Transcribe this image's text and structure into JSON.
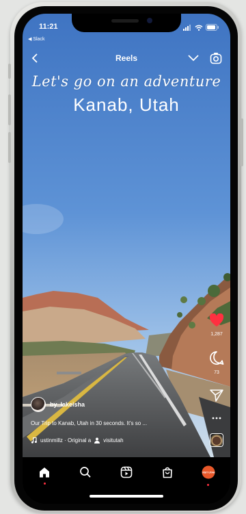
{
  "status_bar": {
    "time": "11:21",
    "back_app": "◀ Slack"
  },
  "header": {
    "title": "Reels"
  },
  "overlay": {
    "script_text": "Let's go on an adventure",
    "location_text": "Kanab, Utah"
  },
  "actions": {
    "likes": "1,287",
    "comments": "73"
  },
  "post": {
    "username": "by_lakeisha",
    "caption": "Our Trip to Kanab, Utah in 30 seconds. It's so ...",
    "audio": "ustinmillz · Original a",
    "tagged_user": "visitutah"
  },
  "tabbar": {
    "profile_label": "VISIT UTAH"
  },
  "colors": {
    "like": "#ff3040",
    "sky_top": "#3e74c4",
    "sky_bottom": "#a9c9ea",
    "road": "#5a5b5d"
  }
}
